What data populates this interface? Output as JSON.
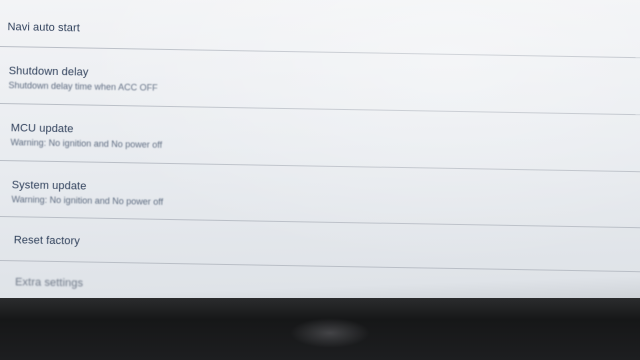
{
  "settings": {
    "items": [
      {
        "title": "Navi auto start",
        "subtitle": ""
      },
      {
        "title": "Shutdown delay",
        "subtitle": "Shutdown delay time when ACC OFF"
      },
      {
        "title": "MCU update",
        "subtitle": "Warning: No ignition and No power off"
      },
      {
        "title": "System update",
        "subtitle": "Warning: No ignition and No power off"
      },
      {
        "title": "Reset factory",
        "subtitle": ""
      },
      {
        "title": "Extra settings",
        "subtitle": ""
      }
    ]
  }
}
